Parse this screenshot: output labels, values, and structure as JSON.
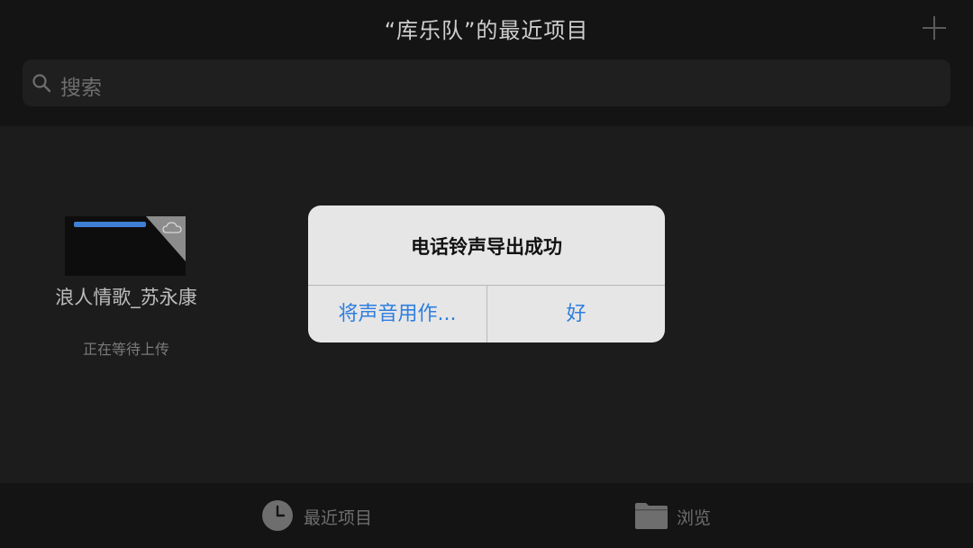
{
  "header": {
    "title": "“库乐队”的最近项目",
    "add_icon": "plus-icon"
  },
  "search": {
    "placeholder": "搜索",
    "icon": "search-icon"
  },
  "files": [
    {
      "name": "浪人情歌_苏永康",
      "status": "正在等待上传"
    }
  ],
  "alert": {
    "title": "电话铃声导出成功",
    "buttons": {
      "use_as": "将声音用作...",
      "ok": "好"
    },
    "button_color": "#2f7ee0"
  },
  "tabbar": {
    "recent": "最近项目",
    "browse": "浏览"
  }
}
